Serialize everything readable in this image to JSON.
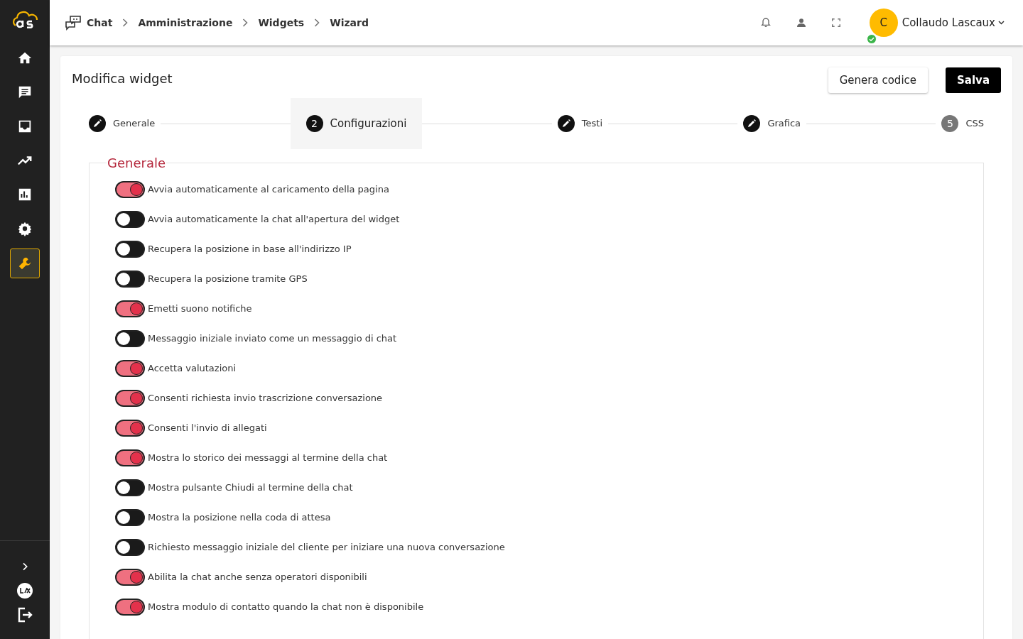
{
  "sidebar": {
    "items": [
      {
        "selected": false
      },
      {
        "selected": false
      },
      {
        "selected": false
      },
      {
        "selected": false
      },
      {
        "selected": false
      },
      {
        "selected": false
      },
      {
        "selected": true
      }
    ]
  },
  "breadcrumb": [
    "Chat",
    "Amministrazione",
    "Widgets",
    "Wizard"
  ],
  "user": {
    "initial": "C",
    "name": "Collaudo Lascaux",
    "online": true
  },
  "page": {
    "title": "Modifica widget",
    "buttons": [
      {
        "label": "Genera codice",
        "kind": "secondary"
      },
      {
        "label": "Salva",
        "kind": "primary"
      }
    ]
  },
  "steps": [
    {
      "label": "Generale",
      "kind": "edit",
      "selected": false
    },
    {
      "label": "Configurazioni",
      "number": "2",
      "kind": "number",
      "selected": true
    },
    {
      "label": "Testi",
      "kind": "edit",
      "selected": false
    },
    {
      "label": "Grafica",
      "kind": "edit",
      "selected": false
    },
    {
      "label": "CSS",
      "number": "5",
      "kind": "number",
      "selected": false
    }
  ],
  "section": {
    "title": "Generale",
    "options": [
      {
        "label": "Avvia automaticamente al caricamento della pagina",
        "on": true
      },
      {
        "label": "Avvia automaticamente la chat all'apertura del widget",
        "on": false
      },
      {
        "label": "Recupera la posizione in base all'indirizzo IP",
        "on": false
      },
      {
        "label": "Recupera la posizione tramite GPS",
        "on": false
      },
      {
        "label": "Emetti suono notifiche",
        "on": true
      },
      {
        "label": "Messaggio iniziale inviato come un messaggio di chat",
        "on": false
      },
      {
        "label": "Accetta valutazioni",
        "on": true
      },
      {
        "label": "Consenti richiesta invio trascrizione conversazione",
        "on": true
      },
      {
        "label": "Consenti l'invio di allegati",
        "on": true
      },
      {
        "label": "Mostra lo storico dei messaggi al termine della chat",
        "on": true
      },
      {
        "label": "Mostra pulsante Chiudi al termine della chat",
        "on": false
      },
      {
        "label": "Mostra la posizione nella coda di attesa",
        "on": false
      },
      {
        "label": "Richiesto messaggio iniziale del cliente per iniziare una nuova conversazione",
        "on": false
      },
      {
        "label": "Abilita la chat anche senza operatori disponibili",
        "on": true
      },
      {
        "label": "Mostra modulo di contatto quando la chat non è disponibile",
        "on": true
      }
    ]
  }
}
